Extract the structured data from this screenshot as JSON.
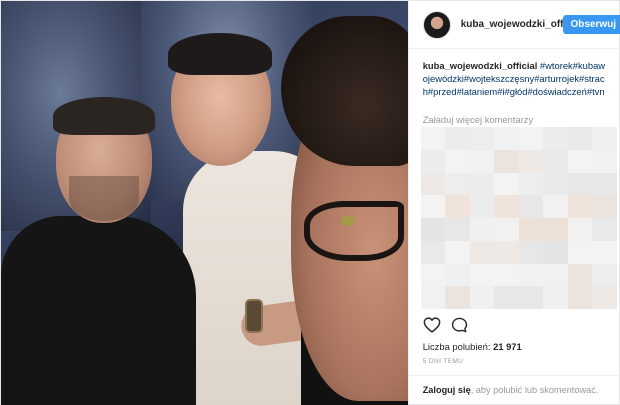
{
  "header": {
    "username": "kuba_wojewodzki_off",
    "follow_label": "Obserwuj"
  },
  "caption": {
    "author": "kuba_wojewodzki_official",
    "tags": " #wtorek#kubawojewódzki#wojtekszczęsny#arturrojek#strach#przed#lataniem#i#głód#doświadczeń#tvn"
  },
  "comments": {
    "load_more": "Załaduj więcej komentarzy"
  },
  "actions": {
    "like_icon": "heart-icon",
    "comment_icon": "comment-icon"
  },
  "likes": {
    "label": "Liczba polubień: ",
    "count": "21 971"
  },
  "timestamp": "5 DNI TEMU",
  "footer": {
    "login_link": "Zaloguj się",
    "login_text": ", aby polubić lub skomentować."
  },
  "colors": {
    "accent": "#3897f0",
    "hashtag": "#003569"
  }
}
